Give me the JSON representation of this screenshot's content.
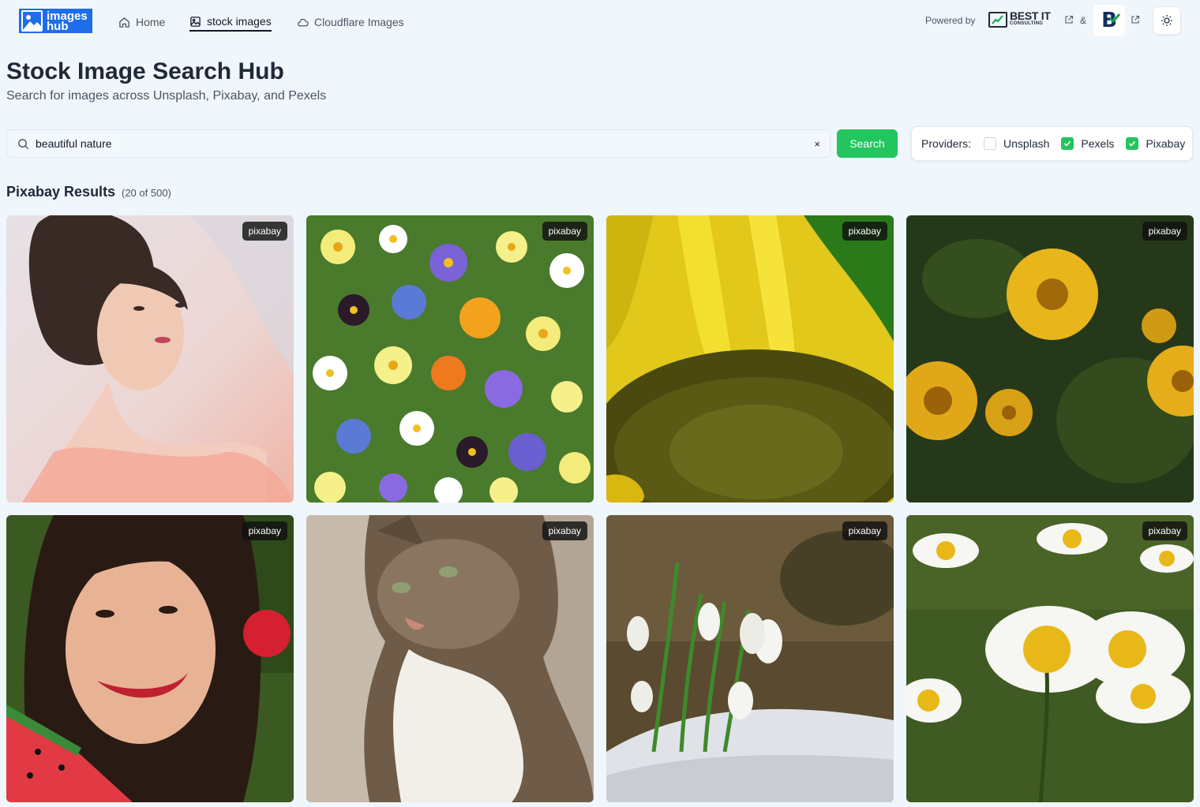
{
  "nav": {
    "logo_line1": "images",
    "logo_line2": "hub",
    "links": [
      {
        "label": "Home",
        "icon": "home-icon"
      },
      {
        "label": "stock images",
        "icon": "image-icon",
        "active": true
      },
      {
        "label": "Cloudflare Images",
        "icon": "cloud-icon"
      }
    ],
    "powered_by": "Powered by",
    "partner1_line1": "BEST IT",
    "partner1_line2": "CONSULTING",
    "ampersand": "&",
    "partner2": "B"
  },
  "header": {
    "title": "Stock Image Search Hub",
    "subtitle": "Search for images across Unsplash, Pixabay, and Pexels"
  },
  "search": {
    "value": "beautiful nature",
    "clear": "×",
    "button": "Search"
  },
  "providers": {
    "label": "Providers:",
    "items": [
      {
        "name": "Unsplash",
        "checked": false
      },
      {
        "name": "Pexels",
        "checked": true
      },
      {
        "name": "Pixabay",
        "checked": true
      }
    ]
  },
  "results": {
    "title": "Pixabay Results",
    "count": "(20 of 500)",
    "cards": [
      {
        "badge": "pixabay",
        "subject": "woman-portrait"
      },
      {
        "badge": "pixabay",
        "subject": "wildflowers"
      },
      {
        "badge": "pixabay",
        "subject": "sunflower"
      },
      {
        "badge": "pixabay",
        "subject": "yellow-daisies"
      },
      {
        "badge": "pixabay",
        "subject": "woman-watermelon"
      },
      {
        "badge": "pixabay",
        "subject": "tabby-cat"
      },
      {
        "badge": "pixabay",
        "subject": "snowdrops"
      },
      {
        "badge": "pixabay",
        "subject": "white-daisies"
      }
    ]
  },
  "colors": {
    "background": "#eff6fc",
    "accent": "#22c55e",
    "logo_blue": "#1d6ee8"
  }
}
